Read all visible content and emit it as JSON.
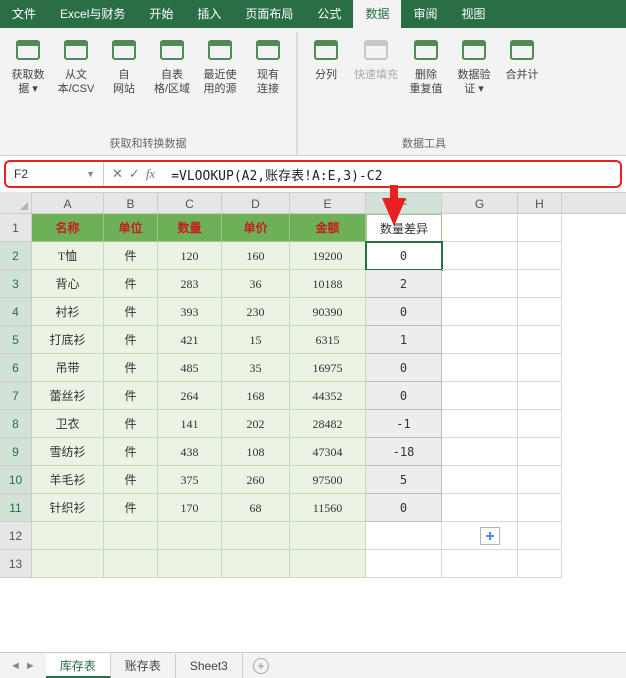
{
  "menu": {
    "items": [
      "文件",
      "Excel与财务",
      "开始",
      "插入",
      "页面布局",
      "公式",
      "数据",
      "审阅",
      "视图"
    ],
    "active": 6
  },
  "ribbon": {
    "group1": {
      "title": "获取和转换数据",
      "btns": [
        {
          "label": "获取数\n据 ▾"
        },
        {
          "label": "从文\n本/CSV"
        },
        {
          "label": "自\n网站"
        },
        {
          "label": "自表\n格/区域"
        },
        {
          "label": "最近使\n用的源"
        },
        {
          "label": "现有\n连接"
        }
      ]
    },
    "group2": {
      "title": "数据工具",
      "btns": [
        {
          "label": "分列"
        },
        {
          "label": "快速填充",
          "disabled": true
        },
        {
          "label": "删除\n重复值"
        },
        {
          "label": "数据验\n证 ▾"
        },
        {
          "label": "合并计"
        }
      ]
    }
  },
  "name_box": "F2",
  "formula": "=VLOOKUP(A2,账存表!A:E,3)-C2",
  "columns": [
    "A",
    "B",
    "C",
    "D",
    "E",
    "F",
    "G",
    "H"
  ],
  "header_row": [
    "名称",
    "单位",
    "数量",
    "单价",
    "金额"
  ],
  "f_header": "数量差异",
  "rows": [
    {
      "n": "T恤",
      "u": "件",
      "q": "120",
      "p": "160",
      "a": "19200",
      "d": "0"
    },
    {
      "n": "背心",
      "u": "件",
      "q": "283",
      "p": "36",
      "a": "10188",
      "d": "2"
    },
    {
      "n": "衬衫",
      "u": "件",
      "q": "393",
      "p": "230",
      "a": "90390",
      "d": "0"
    },
    {
      "n": "打底衫",
      "u": "件",
      "q": "421",
      "p": "15",
      "a": "6315",
      "d": "1"
    },
    {
      "n": "吊带",
      "u": "件",
      "q": "485",
      "p": "35",
      "a": "16975",
      "d": "0"
    },
    {
      "n": "蕾丝衫",
      "u": "件",
      "q": "264",
      "p": "168",
      "a": "44352",
      "d": "0"
    },
    {
      "n": "卫衣",
      "u": "件",
      "q": "141",
      "p": "202",
      "a": "28482",
      "d": "-1"
    },
    {
      "n": "雪纺衫",
      "u": "件",
      "q": "438",
      "p": "108",
      "a": "47304",
      "d": "-18"
    },
    {
      "n": "羊毛衫",
      "u": "件",
      "q": "375",
      "p": "260",
      "a": "97500",
      "d": "5"
    },
    {
      "n": "针织衫",
      "u": "件",
      "q": "170",
      "p": "68",
      "a": "11560",
      "d": "0"
    }
  ],
  "tabs": {
    "items": [
      "库存表",
      "账存表",
      "Sheet3"
    ],
    "active": 0
  }
}
